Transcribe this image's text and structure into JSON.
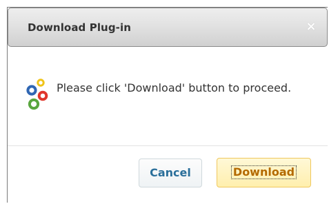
{
  "dialog": {
    "title": "Download Plug-in",
    "close_glyph": "×",
    "message": "Please click 'Download' button to proceed.",
    "icon": "plugin-dots-icon"
  },
  "buttons": {
    "cancel_label": "Cancel",
    "download_label": "Download"
  },
  "colors": {
    "titlebar_top": "#eeeeee",
    "titlebar_bottom": "#d0d0d0",
    "cancel_text": "#2a6f9a",
    "download_bg": "#ffefad",
    "download_text": "#b46a00",
    "icon_blue": "#2f66b3",
    "icon_yellow": "#f0c419",
    "icon_red": "#e0362c",
    "icon_green": "#5aa63f"
  }
}
